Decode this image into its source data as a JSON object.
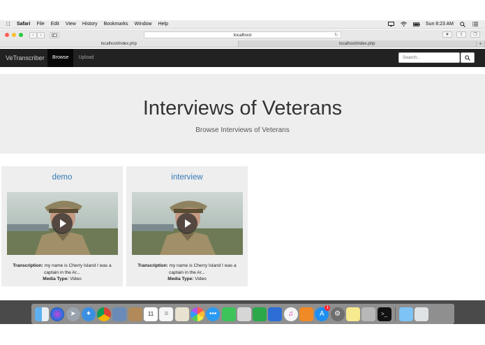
{
  "menubar": {
    "apple_icon": "apple-logo-icon",
    "app_name": "Safari",
    "items": [
      "File",
      "Edit",
      "View",
      "History",
      "Bookmarks",
      "Window",
      "Help"
    ],
    "clock": "Sun 8:23 AM"
  },
  "browser": {
    "url": "localhost",
    "tabs": [
      "localhost/index.php",
      "localhost/index.php"
    ],
    "new_tab": "+"
  },
  "navbar": {
    "brand": "VeTranscriber",
    "links": [
      "Browse",
      "Upload"
    ],
    "search_placeholder": "Search..",
    "active_color": "#080808",
    "bg_color": "#222222"
  },
  "jumbotron": {
    "title": "Interviews of Veterans",
    "subtitle": "Browse Interviews of Veterans"
  },
  "cards": [
    {
      "title": "demo",
      "transcription_label": "Transcription:",
      "transcription_line1": "my name is Cherry Island I was a",
      "transcription_line2": "captain in the Ar...",
      "media_label": "Media Type:",
      "media_value": "Video"
    },
    {
      "title": "interview",
      "transcription_label": "Transcription:",
      "transcription_line1": "my name is Cherry Island I was a",
      "transcription_line2": "captain in the Ar...",
      "media_label": "Media Type:",
      "media_value": "Video"
    }
  ],
  "dock": {
    "icons": [
      "finder-icon",
      "siri-icon",
      "launchpad-icon",
      "safari-icon",
      "chrome-icon",
      "preview-icon",
      "notes-book-icon",
      "calendar-icon",
      "reminders-icon",
      "textedit-icon",
      "photos-icon",
      "messages-icon",
      "facetime-icon",
      "mail-icon",
      "numbers-icon",
      "keynote-icon",
      "itunes-icon",
      "ibooks-icon",
      "appstore-icon",
      "system-preferences-icon",
      "stickies-icon",
      "xcode-sim-icon",
      "terminal-icon",
      "folder-icon",
      "trash-icon"
    ],
    "calendar_day": "11",
    "appstore_badge": "1"
  },
  "colors": {
    "link_blue": "#337ab7",
    "jumbotron_bg": "#eeeeee"
  }
}
